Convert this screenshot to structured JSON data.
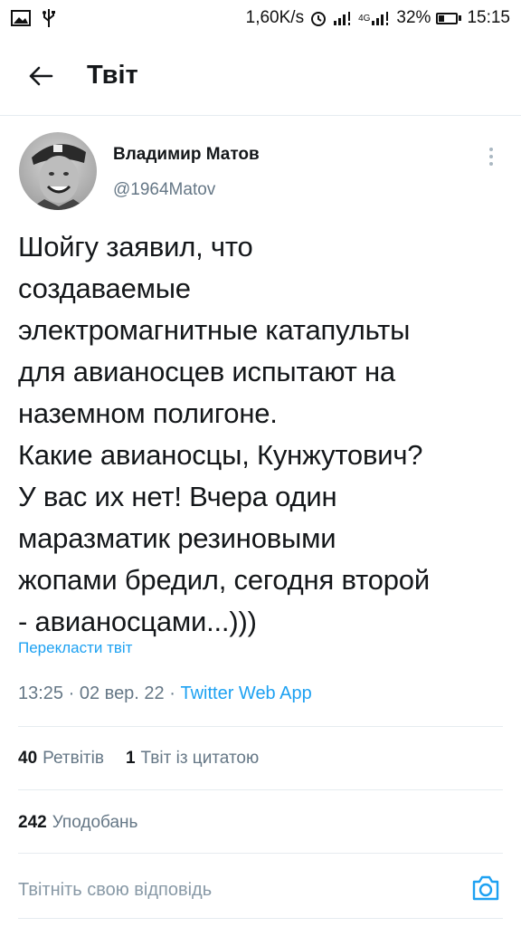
{
  "status_bar": {
    "speed": "1,60K/s",
    "network": "4G",
    "battery_percent": "32%",
    "battery_level": 0.32,
    "time": "15:15",
    "icons": [
      "image-icon",
      "usb-icon",
      "alarm-icon",
      "signal-icon",
      "signal-4g-icon",
      "battery-icon"
    ]
  },
  "header": {
    "title": "Твіт",
    "back_icon": "arrow-left-icon"
  },
  "tweet": {
    "author_name": "Владимир Матов",
    "author_handle": "@1964Matov",
    "text": "Шойгу заявил, что\nсоздаваемые\nэлектромагнитные катапульты\nдля авианосцев испытают на\nназемном полигоне.\nКакие авианосцы, Кунжутович?\nУ вас их нет! Вчера один\nмаразматик резиновыми\nжопами бредил, сегодня второй\n- авианосцами...)))",
    "translate_label": "Перекласти твіт",
    "time": "13:25",
    "separator": "·",
    "date": "02 вер. 22",
    "source": "Twitter Web App"
  },
  "stats": {
    "retweets_count": "40",
    "retweets_label": "Ретвітів",
    "quotes_count": "1",
    "quotes_label": "Твіт із цитатою",
    "likes_count": "242",
    "likes_label": "Уподобань"
  },
  "reply": {
    "placeholder": "Твітніть свою відповідь",
    "camera_icon": "camera-icon"
  },
  "colors": {
    "accent": "#1da1f2",
    "secondary_text": "#657786",
    "divider": "#e6ecf0"
  }
}
